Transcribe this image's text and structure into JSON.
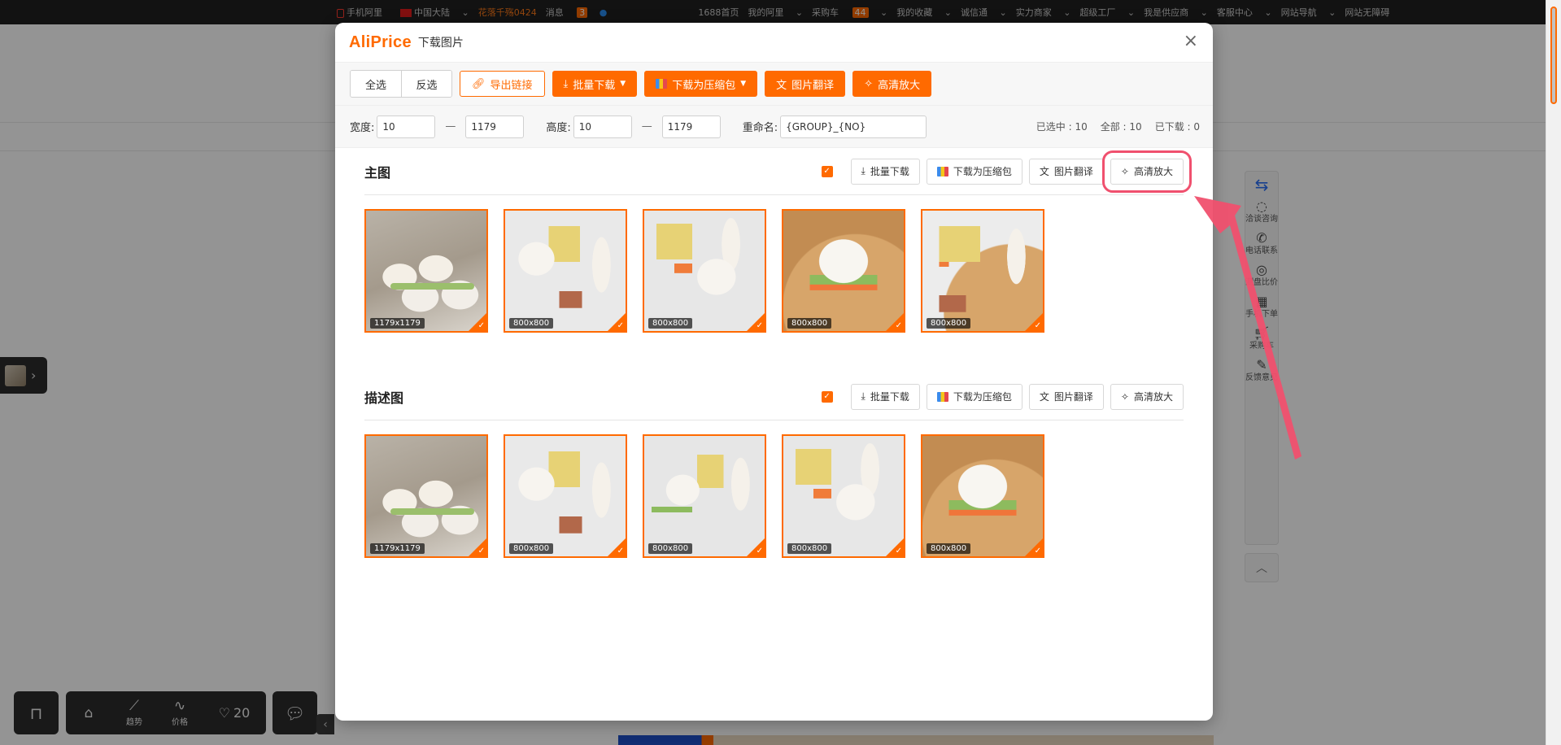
{
  "topbar": {
    "items": [
      "手机阿里",
      "中国大陆",
      "花落千殇0424",
      "消息",
      "1688首页",
      "我的阿里",
      "采购车",
      "我的收藏",
      "诚信通",
      "实力商家",
      "超级工厂",
      "我是供应商",
      "客服中心",
      "网站导航",
      "网站无障碍"
    ],
    "message_count": "3",
    "cart_count": "44"
  },
  "modal": {
    "logo": "AliPrice",
    "title": "下载图片",
    "close_icon": "×",
    "toolbar": {
      "select_all": "全选",
      "invert": "反选",
      "export_links": "导出链接",
      "batch_download": "批量下载",
      "download_zip": "下载为压缩包",
      "translate": "图片翻译",
      "upscale": "高清放大"
    },
    "filter": {
      "width_label": "宽度:",
      "width_min": "10",
      "width_max": "1179",
      "height_label": "高度:",
      "height_min": "10",
      "height_max": "1179",
      "rename_label": "重命名:",
      "rename_value": "{GROUP}_{NO}",
      "selected": "已选中 : 10",
      "total": "全部 : 10",
      "downloaded": "已下载 : 0"
    },
    "sections": [
      {
        "title": "主图",
        "actions": {
          "batch_download": "批量下载",
          "download_zip": "下载为压缩包",
          "translate": "图片翻译",
          "upscale": "高清放大"
        },
        "images": [
          {
            "size": "1179x1179"
          },
          {
            "size": "800x800"
          },
          {
            "size": "800x800"
          },
          {
            "size": "800x800"
          },
          {
            "size": "800x800"
          }
        ]
      },
      {
        "title": "描述图",
        "actions": {
          "batch_download": "批量下载",
          "download_zip": "下载为压缩包",
          "translate": "图片翻译",
          "upscale": "高清放大"
        },
        "images": [
          {
            "size": "1179x1179"
          },
          {
            "size": "800x800"
          },
          {
            "size": "800x800"
          },
          {
            "size": "800x800"
          },
          {
            "size": "800x800"
          }
        ]
      }
    ]
  },
  "sidebar": {
    "items": [
      "洽谈咨询",
      "电话联系",
      "测盘比价",
      "手机下单",
      "采购车",
      "反馈意见"
    ]
  },
  "bottom_bar": {
    "trend": "趋势",
    "price": "价格",
    "favorites": "20"
  },
  "colors": {
    "accent": "#ff6a00",
    "highlight": "#f0506e"
  }
}
